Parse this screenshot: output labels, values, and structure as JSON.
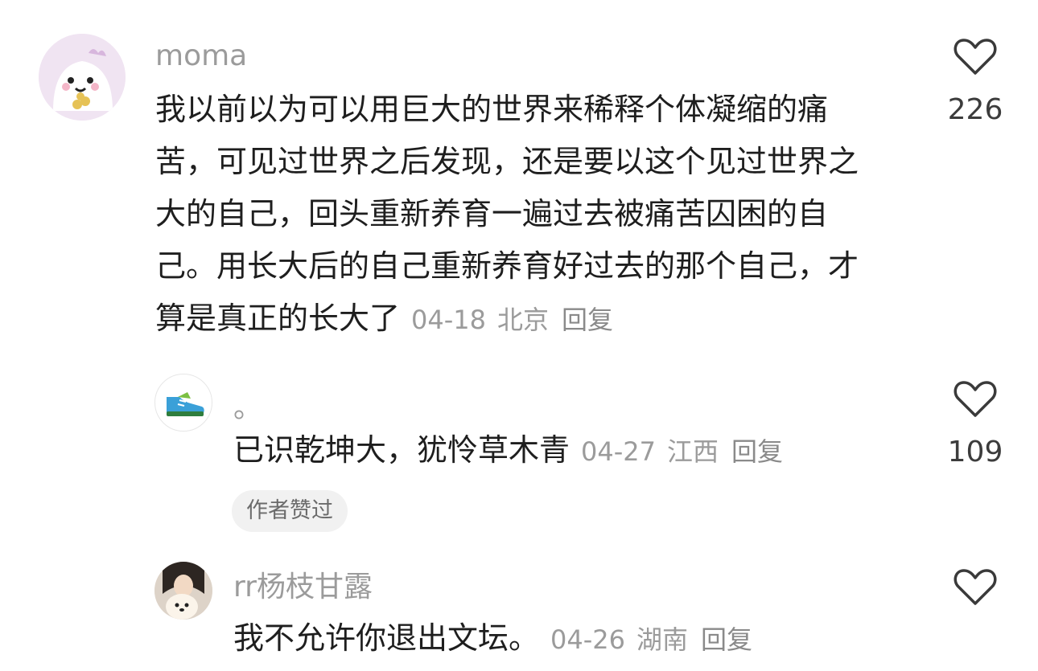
{
  "comments": [
    {
      "username": "moma",
      "text": "我以前以为可以用巨大的世界来稀释个体凝缩的痛苦，可见过世界之后发现，还是要以这个见过世界之大的自己，回头重新养育一遍过去被痛苦囚困的自己。用长大后的自己重新养育好过去的那个自己，才算是真正的长大了",
      "date": "04-18",
      "location": "北京",
      "reply_label": "回复",
      "like_count": "226"
    },
    {
      "username": "。",
      "text": "已识乾坤大，犹怜草木青",
      "date": "04-27",
      "location": "江西",
      "reply_label": "回复",
      "like_count": "109",
      "badge": "作者赞过"
    },
    {
      "username": "rr杨枝甘露",
      "text": "我不允许你退出文坛。",
      "date": "04-26",
      "location": "湖南",
      "reply_label": "回复",
      "like_count": ""
    }
  ]
}
